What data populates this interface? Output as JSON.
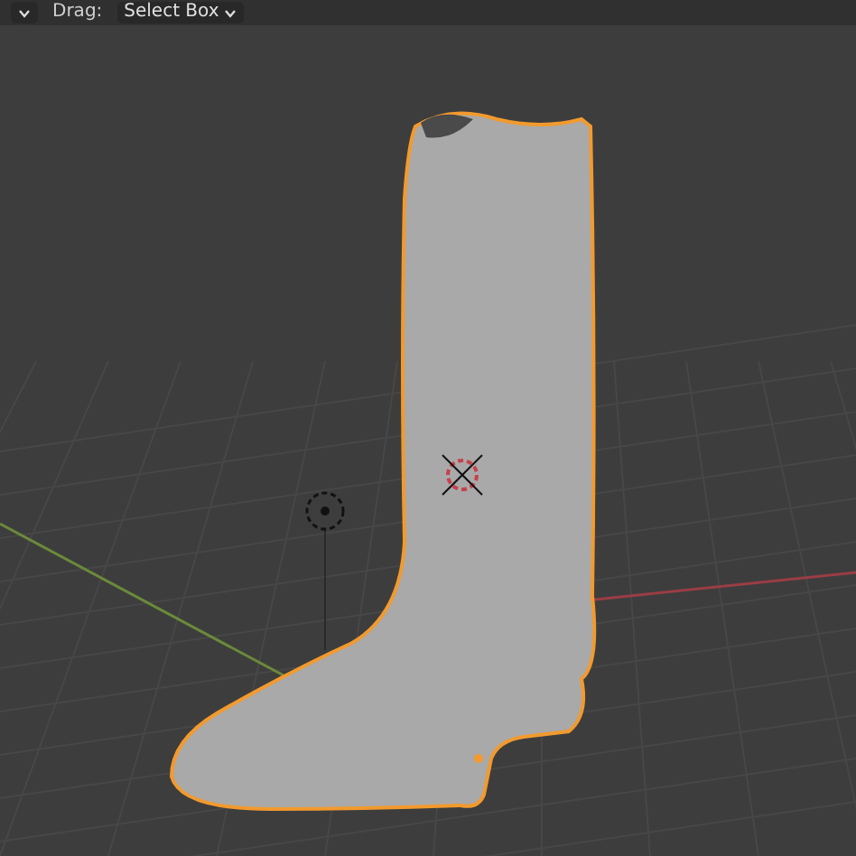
{
  "header": {
    "drag_label": "Drag:",
    "tool_dropdown": "Select Box"
  }
}
